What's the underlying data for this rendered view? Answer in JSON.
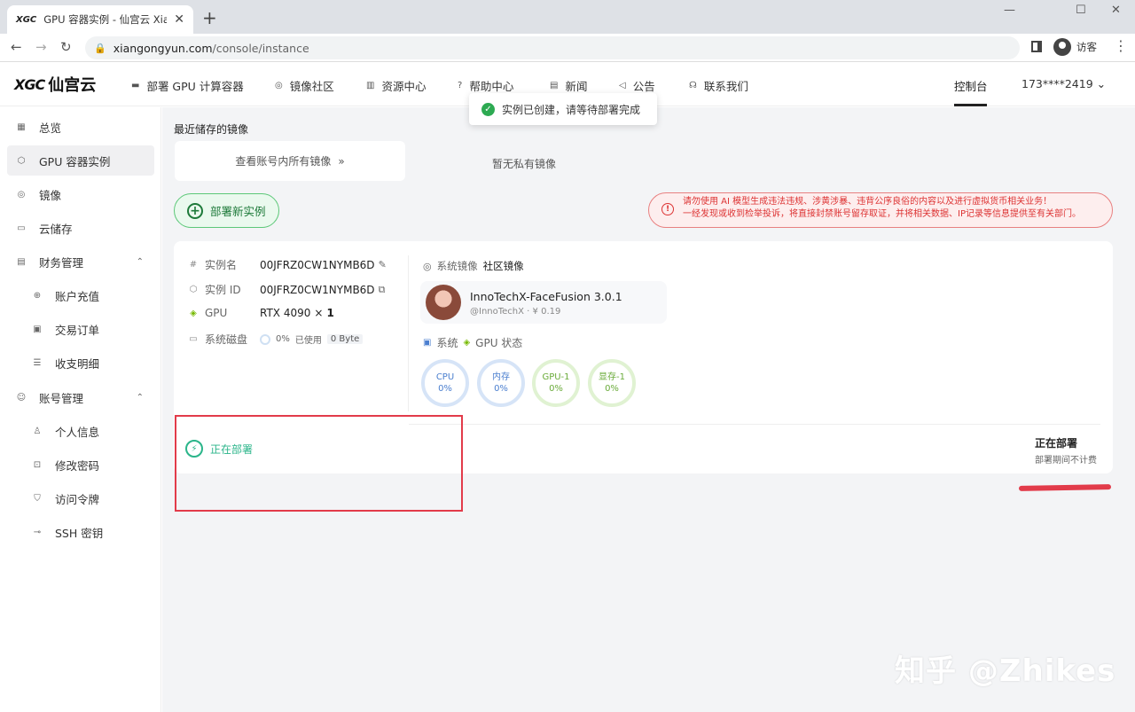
{
  "browser": {
    "tab_title": "GPU 容器实例 - 仙宫云 Xiangong",
    "tab_favicon": "XGC",
    "tab_close": "✕",
    "new_tab": "+",
    "win_min": "—",
    "win_max": "☐",
    "win_close": "✕",
    "back": "←",
    "forward": "→",
    "reload": "↻",
    "lock": "🔒",
    "url_domain": "xiangongyun.com",
    "url_path": "/console/instance",
    "profile_label": "访客",
    "menu": "⋮"
  },
  "header": {
    "logo_mark": "XGC",
    "logo_name": "仙宫云",
    "nav": [
      {
        "icon": "▬",
        "label": "部署 GPU 计算容器"
      },
      {
        "icon": "◎",
        "label": "镜像社区"
      },
      {
        "icon": "▥",
        "label": "资源中心"
      },
      {
        "icon": "?",
        "label": "帮助中心"
      },
      {
        "icon": "▤",
        "label": "新闻"
      },
      {
        "icon": "◁",
        "label": "公告"
      },
      {
        "icon": "☊",
        "label": "联系我们"
      }
    ],
    "console_label": "控制台",
    "user_label": "173****2419 ⌄"
  },
  "sidebar": {
    "items": [
      {
        "icon": "▦",
        "label": "总览"
      },
      {
        "icon": "⬡",
        "label": "GPU 容器实例"
      },
      {
        "icon": "◎",
        "label": "镜像"
      },
      {
        "icon": "▭",
        "label": "云储存"
      },
      {
        "icon": "▤",
        "label": "财务管理",
        "caret": "⌃"
      },
      {
        "icon": "⊕",
        "label": "账户充值"
      },
      {
        "icon": "▣",
        "label": "交易订单"
      },
      {
        "icon": "☰",
        "label": "收支明细"
      },
      {
        "icon": "☺",
        "label": "账号管理",
        "caret": "⌃"
      },
      {
        "icon": "♙",
        "label": "个人信息"
      },
      {
        "icon": "⊡",
        "label": "修改密码"
      },
      {
        "icon": "⛉",
        "label": "访问令牌"
      },
      {
        "icon": "⊸",
        "label": "SSH 密钥"
      }
    ]
  },
  "main": {
    "toast": "实例已创建，请等待部署完成",
    "recent_images_title": "最近储存的镜像",
    "view_all_images": "查看账号内所有镜像",
    "view_all_arrow": "»",
    "no_private_images": "暂无私有镜像",
    "deploy_new_button": "部署新实例",
    "warning_line1": "请勿使用 AI 模型生成违法违规、涉黄涉暴、违背公序良俗的内容以及进行虚拟货币相关业务！",
    "warning_line2": "一经发现或收到检举投诉，将直接封禁账号留存取证，并将相关数据、IP记录等信息提供至有关部门。",
    "instance": {
      "name_label": "实例名",
      "name_value": "00JFRZ0CW1NYMB6D",
      "id_label": "实例 ID",
      "id_value": "00JFRZ0CW1NYMB6D",
      "gpu_label": "GPU",
      "gpu_model": "RTX 4090",
      "gpu_times": "×",
      "gpu_count": "1",
      "disk_label": "系统磁盘",
      "disk_percent": "0%",
      "disk_used_label": "已使用",
      "disk_used_value": "0 Byte",
      "system_image_label": "系统镜像",
      "system_image_tag": "社区镜像",
      "image_name": "InnoTechX-FaceFusion 3.0.1",
      "image_author": "@InnoTechX",
      "image_price": "¥ 0.19",
      "system_label": "系统",
      "gpu_status_label": "GPU 状态",
      "gauges": [
        {
          "label": "CPU",
          "value": "0%",
          "color": "#d6e4f7"
        },
        {
          "label": "内存",
          "value": "0%",
          "color": "#d6e4f7"
        },
        {
          "label": "GPU-1",
          "value": "0%",
          "color": "#e0f2d2"
        },
        {
          "label": "显存-1",
          "value": "0%",
          "color": "#e0f2d2"
        }
      ],
      "deploying_label": "正在部署",
      "status_title": "正在部署",
      "status_sub": "部署期间不计费"
    },
    "watermark": "知乎 @Zhikes"
  }
}
